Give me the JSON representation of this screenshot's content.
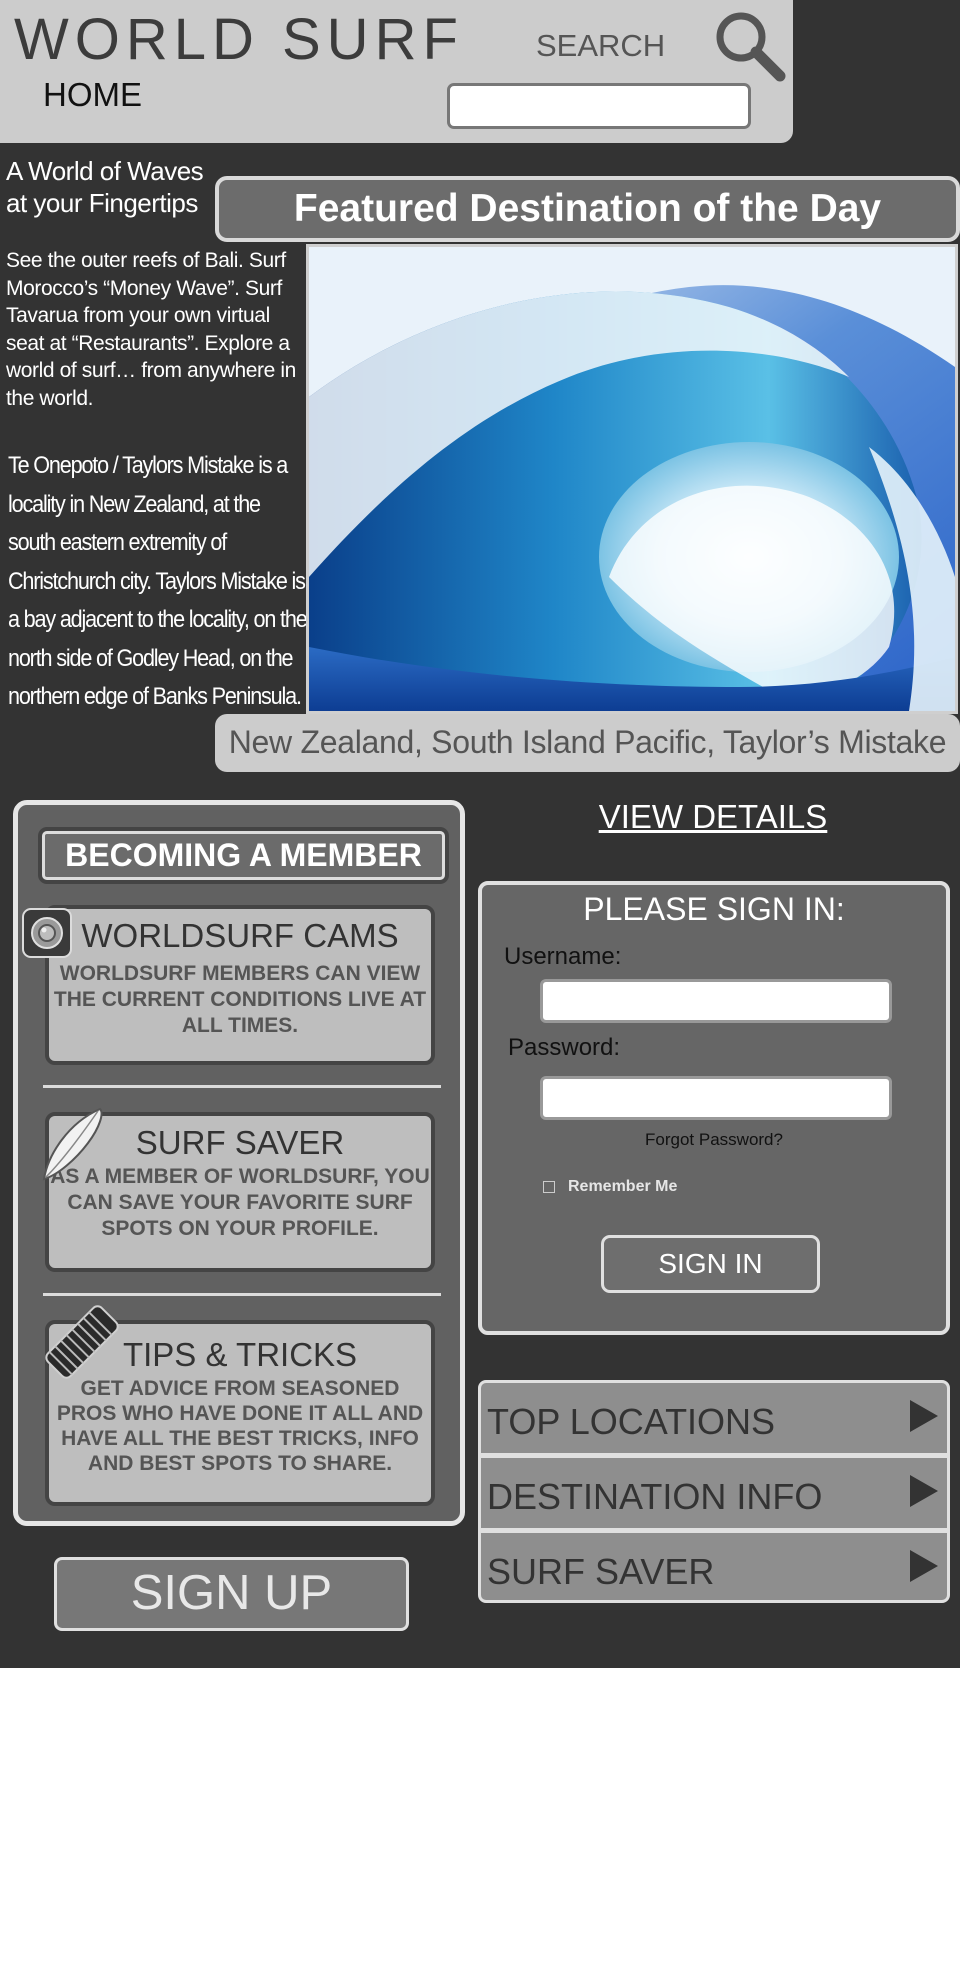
{
  "header": {
    "logo": "WORLD SURF",
    "home_label": "HOME",
    "search_label": "SEARCH",
    "search_value": ""
  },
  "intro": {
    "tagline": "A World of Waves at your Fingertips",
    "text": "See the outer reefs of Bali. Surf Morocco’s “Money Wave”. Surf Tavarua from your own virtual seat at “Restaurants”. Explore a world of surf… from anywhere in the world.",
    "description": "Te Onepoto / Taylors Mistake is a locality in New Zealand, at the south eastern extremity of Christchurch city. Taylors Mistake is a bay adjacent to the locality, on the north side of Godley Head, on the northern edge of Banks Peninsula."
  },
  "featured": {
    "title": "Featured Destination of the Day",
    "caption": "New Zealand, South Island Pacific, Taylor’s Mistake",
    "view_details": "VIEW DETAILS"
  },
  "membership": {
    "header": "BECOMING A MEMBER",
    "cards": [
      {
        "title": "WORLDSURF CAMS",
        "desc": "WORLDSURF MEMBERS CAN VIEW THE CURRENT CONDITIONS LIVE AT ALL TIMES.",
        "icon": "camera-icon"
      },
      {
        "title": "SURF SAVER",
        "desc": "AS A MEMBER OF WORLDSURF, YOU CAN SAVE YOUR FAVORITE SURF SPOTS ON YOUR PROFILE.",
        "icon": "surfboard-icon"
      },
      {
        "title": "TIPS & TRICKS",
        "desc": "GET ADVICE FROM SEASONED PROS WHO HAVE DONE IT ALL AND HAVE ALL THE BEST TRICKS, INFO AND BEST SPOTS TO SHARE.",
        "icon": "surfboard-stack-icon"
      }
    ],
    "signup_label": "SIGN UP"
  },
  "signin": {
    "title": "PLEASE SIGN IN:",
    "username_label": "Username:",
    "username_value": "",
    "password_label": "Password:",
    "password_value": "",
    "forgot_label": "Forgot Password?",
    "remember_label": "Remember Me",
    "remember_checked": false,
    "button_label": "SIGN IN"
  },
  "nav": {
    "items": [
      {
        "label": "TOP LOCATIONS",
        "icon": "play-arrow-icon"
      },
      {
        "label": "DESTINATION INFO",
        "icon": "play-arrow-icon"
      },
      {
        "label": "SURF SAVER",
        "icon": "play-arrow-icon"
      }
    ]
  },
  "colors": {
    "page_background": "#333333",
    "header_background": "#cccccc",
    "panel_background": "#616161",
    "card_background": "#bebebe",
    "nav_item_background": "#8e8e8e"
  }
}
